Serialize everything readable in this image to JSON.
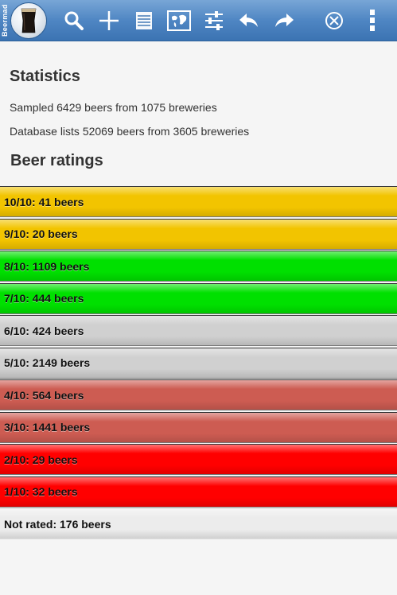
{
  "app": {
    "name": "Beermad"
  },
  "toolbar": {
    "icons": [
      "search-icon",
      "add-icon",
      "list-icon",
      "map-icon",
      "settings-sliders-icon",
      "undo-arrow-icon",
      "redo-arrow-icon",
      "close-circle-icon",
      "overflow-menu-icon"
    ]
  },
  "statistics": {
    "heading": "Statistics",
    "sampled": "Sampled 6429 beers from 1075 breweries",
    "database": "Database lists 52069 beers from 3605 breweries"
  },
  "ratings": {
    "heading": "Beer ratings",
    "rows": [
      {
        "label": "10/10: 41 beers",
        "color": "#f2c400"
      },
      {
        "label": "9/10: 20 beers",
        "color": "#f2c400"
      },
      {
        "label": "8/10: 1109 beers",
        "color": "#00e000"
      },
      {
        "label": "7/10: 444 beers",
        "color": "#00e000"
      },
      {
        "label": "6/10: 424 beers",
        "color": "#d0d0d0"
      },
      {
        "label": "5/10: 2149 beers",
        "color": "#d0d0d0"
      },
      {
        "label": "4/10: 564 beers",
        "color": "#cd5c52"
      },
      {
        "label": "3/10: 1441 beers",
        "color": "#cd5c52"
      },
      {
        "label": "2/10: 29 beers",
        "color": "#ff0000"
      },
      {
        "label": "1/10: 32 beers",
        "color": "#ff0000"
      },
      {
        "label": "Not rated: 176 beers",
        "color": "#ececec"
      }
    ]
  }
}
